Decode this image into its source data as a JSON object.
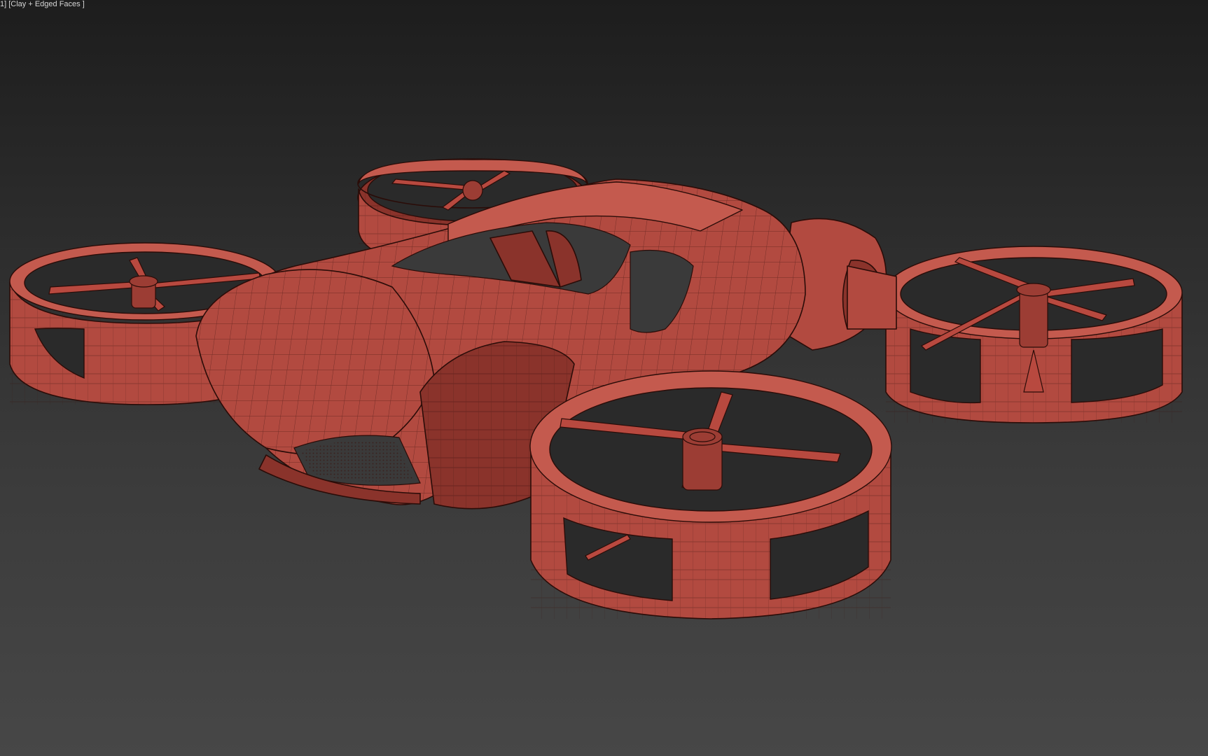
{
  "viewport": {
    "label": "1] [Clay + Edged Faces ]",
    "shading_mode": "Clay + Edged Faces",
    "background_top_color": "#1d1d1d",
    "background_bottom_color": "#474747",
    "model_color": "#b24a40",
    "edge_color": "#2a0c08"
  },
  "icons": {
    "model": "flying-car-drone-icon"
  }
}
